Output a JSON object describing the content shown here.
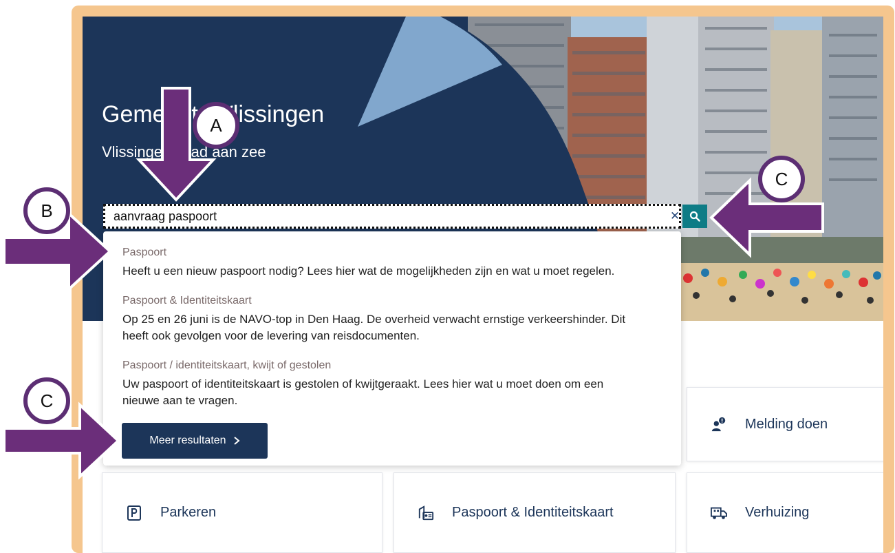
{
  "hero": {
    "title": "Gemeente Vlissingen",
    "subtitle": "Vlissingen, stad aan zee"
  },
  "search": {
    "value": "aanvraag paspoort",
    "clear_icon": "close-icon",
    "submit_icon": "search-icon"
  },
  "suggestions": [
    {
      "title": "Paspoort",
      "lines": [
        "Heeft u een nieuw paspoort nodig? Lees hier wat de mogelijkheden zijn en wat u moet regelen."
      ]
    },
    {
      "title": "Paspoort & Identiteitskaart",
      "lines": [
        "Op 25 en 26 juni is de NAVO-top in Den Haag. De overheid verwacht ernstige verkeershinder. Dit",
        "heeft ook gevolgen voor de levering van reisdocumenten."
      ]
    },
    {
      "title": "Paspoort / identiteitskaart, kwijt of gestolen",
      "lines": [
        "Uw paspoort of identiteitskaart is gestolen of kwijtgeraakt. Lees hier wat u moet doen om een",
        "nieuwe aan te vragen."
      ]
    }
  ],
  "more_button": {
    "label": "Meer resultaten",
    "icon": "chevron-right-icon"
  },
  "tiles": [
    {
      "label": "Melding doen",
      "icon": "person-alert-icon"
    },
    {
      "label": "Parkeren",
      "icon": "parking-icon"
    },
    {
      "label": "Paspoort & Identiteitskaart",
      "icon": "id-card-icon"
    },
    {
      "label": "Verhuizing",
      "icon": "moving-truck-icon"
    }
  ],
  "annotations": {
    "badge_a": "A",
    "badge_b": "B",
    "badge_c_search": "C",
    "badge_c_more": "C"
  },
  "colors": {
    "navy": "#1c3559",
    "teal": "#0e7c86",
    "annotation_purple": "#5c2e73",
    "frame": "#f5c68e"
  }
}
